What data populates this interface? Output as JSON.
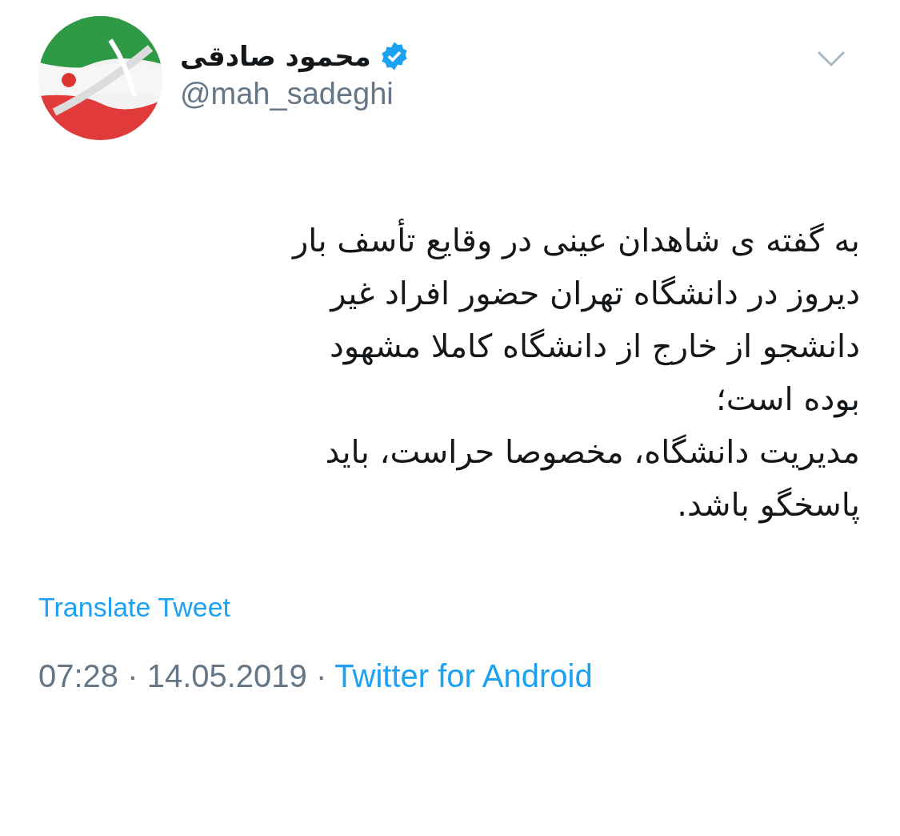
{
  "author": {
    "name": "محمود صادقی",
    "handle": "@mah_sadeghi",
    "verified": true
  },
  "tweet": {
    "lines": [
      "به گفته ی شاهدان عینی در وقایع تأسف بار",
      "دیروز در دانشگاه تهران حضور افراد غیر",
      "دانشجو از خارج از دانشگاه کاملا مشهود",
      "بوده است؛",
      "مدیریت دانشگاه، مخصوصا حراست، باید",
      "پاسخگو باشد."
    ]
  },
  "translate_link": "Translate Tweet",
  "meta": {
    "timestamp": "07:28 · 14.05.2019 ·",
    "source": "Twitter for Android"
  }
}
